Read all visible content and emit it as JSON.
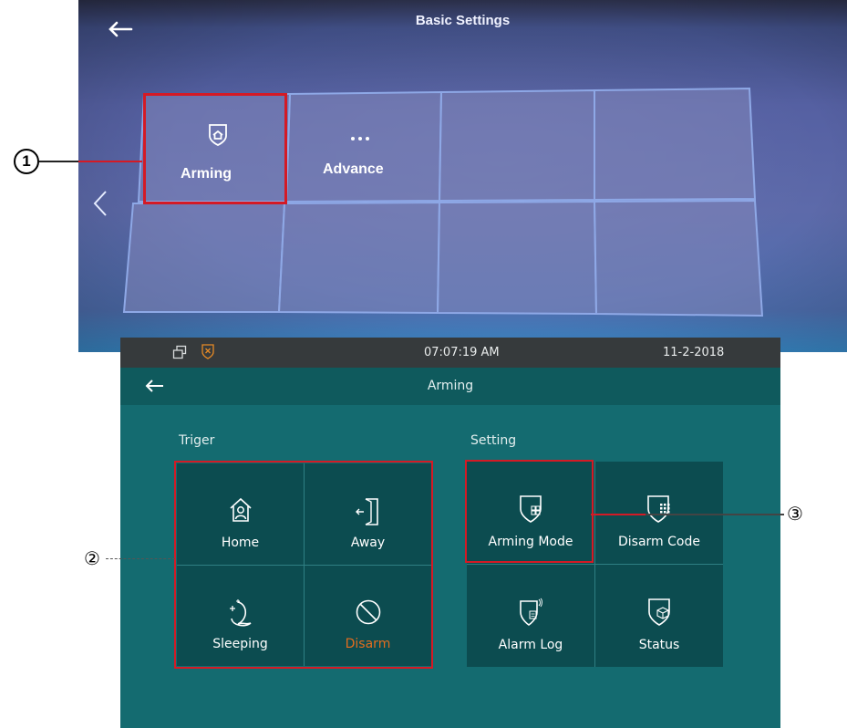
{
  "top": {
    "title": "Basic Settings",
    "tiles": {
      "arming": "Arming",
      "advance": "Advance"
    },
    "callout": "1"
  },
  "status": {
    "time": "07:07:19   AM",
    "date": "11-2-2018"
  },
  "header": {
    "title": "Arming"
  },
  "triger": {
    "label": "Triger",
    "buttons": {
      "home": "Home",
      "away": "Away",
      "sleeping": "Sleeping",
      "disarm": "Disarm"
    }
  },
  "setting": {
    "label": "Setting",
    "buttons": {
      "arming_mode": "Arming Mode",
      "disarm_code": "Disarm Code",
      "alarm_log": "Alarm Log",
      "status": "Status"
    }
  },
  "callouts": {
    "two": "②",
    "three": "③"
  },
  "colors": {
    "accent_orange": "#e36d1e",
    "teal_bg": "#146b70",
    "highlight_red": "#d41a25"
  },
  "icons": {
    "arming": "shield-home-icon",
    "advance": "more-dots-icon",
    "home": "home-person-icon",
    "away": "door-exit-icon",
    "sleeping": "moon-stars-icon",
    "disarm": "no-entry-icon",
    "arming_mode": "shield-grid-icon",
    "disarm_code": "shield-keypad-icon",
    "alarm_log": "shield-log-icon",
    "status": "shield-cube-icon"
  }
}
